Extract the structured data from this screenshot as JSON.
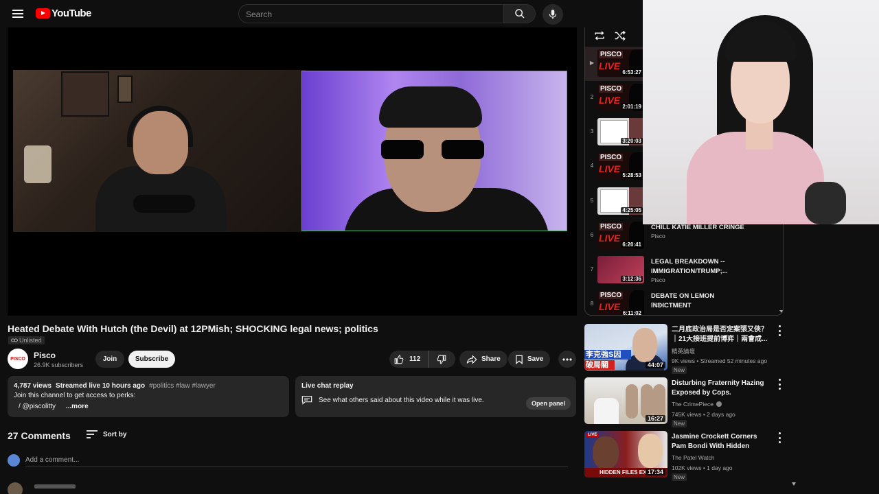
{
  "header": {
    "logo_text": "YouTube",
    "search_placeholder": "Search"
  },
  "video": {
    "title": "Heated Debate With Hutch (the Devil) at 12PMish; SHOCKING legal news; politics",
    "visibility": "Unlisted",
    "channel": {
      "avatar_text": "PISCO",
      "name": "Pisco",
      "subscribers": "26.9K subscribers"
    },
    "join_label": "Join",
    "subscribe_label": "Subscribe",
    "likes": "112",
    "share_label": "Share",
    "save_label": "Save"
  },
  "description": {
    "views": "4,787 views",
    "streamed": "Streamed live 10 hours ago",
    "tags": "#politics #law #lawyer",
    "line1": "Join this channel to get access to perks:",
    "line2": "/ @piscolitty",
    "more": "...more"
  },
  "live_chat": {
    "title": "Live chat replay",
    "text": "See what others said about this video while it was live.",
    "open_panel": "Open panel"
  },
  "comments": {
    "count": "27 Comments",
    "sort_by": "Sort by",
    "add_placeholder": "Add a comment..."
  },
  "playlist": {
    "items": [
      {
        "index": "▶",
        "duration": "6:53:27",
        "thumb": "pisco",
        "title": "",
        "channel": ""
      },
      {
        "index": "2",
        "duration": "2:01:19",
        "thumb": "pisco",
        "title": "",
        "channel": ""
      },
      {
        "index": "3",
        "duration": "3:20:03",
        "thumb": "doc",
        "title": "",
        "channel": ""
      },
      {
        "index": "4",
        "duration": "5:28:53",
        "thumb": "pisco",
        "title": "",
        "channel": ""
      },
      {
        "index": "5",
        "duration": "4:25:05",
        "thumb": "doc",
        "title": "",
        "channel": ""
      },
      {
        "index": "6",
        "duration": "6:20:41",
        "thumb": "pisco",
        "title": "CHILL KATIE MILLER CRINGE",
        "channel": "Pisco"
      },
      {
        "index": "7",
        "duration": "3:12:36",
        "thumb": "fire",
        "title": "LEGAL BREAKDOWN -- IMMIGRATION/TRUMP;...",
        "channel": "Pisco"
      },
      {
        "index": "8",
        "duration": "6:11:02",
        "thumb": "pisco",
        "title": "DEBATE ON LEMON INDICTMENT",
        "channel": "Pisco"
      }
    ]
  },
  "recommendations": [
    {
      "title": "二月底政治局是否定案張又俠？｜21大接班提前博弈｜兩會成...",
      "channel": "精英論壇",
      "meta": "9K views • Streamed 52 minutes ago",
      "badge": "New",
      "duration": "44:07",
      "thumb_text_1": "李克強S因",
      "thumb_text_2": "破局關鍵",
      "verified": false
    },
    {
      "title": "Disturbing Fraternity Hazing Exposed by Cops.",
      "channel": "The CrimePiece",
      "meta": "745K views • 2 days ago",
      "badge": "New",
      "duration": "16:27",
      "verified": true
    },
    {
      "title": "Jasmine Crockett Corners Pam Bondi With Hidden Epstein ...",
      "channel": "The Patel Watch",
      "meta": "102K views • 1 day ago",
      "badge": "New",
      "duration": "17:34",
      "thumb_text_1": "HIDDEN FILES EX",
      "thumb_text_2": "LIVE",
      "verified": false
    }
  ],
  "colors": {
    "background": "#0f0f0f",
    "surface": "#272727",
    "brand_red": "#ff0000",
    "text": "#f1f1f1",
    "muted": "#aaaaaa"
  }
}
